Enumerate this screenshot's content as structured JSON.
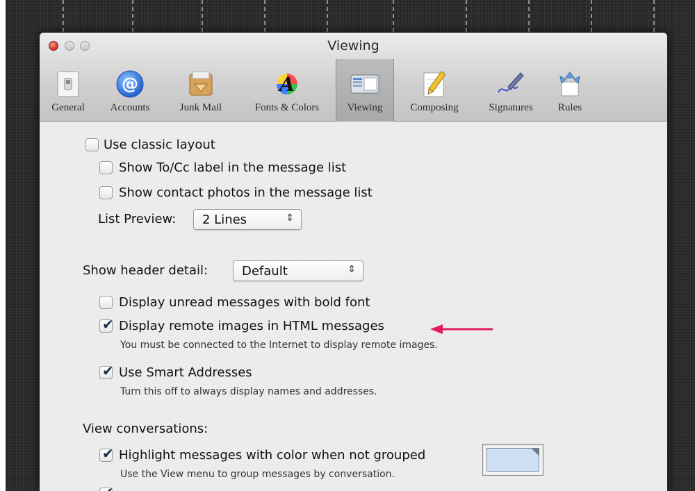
{
  "window": {
    "title": "Viewing"
  },
  "toolbar": {
    "items": [
      {
        "label": "General"
      },
      {
        "label": "Accounts"
      },
      {
        "label": "Junk Mail"
      },
      {
        "label": "Fonts & Colors"
      },
      {
        "label": "Viewing"
      },
      {
        "label": "Composing"
      },
      {
        "label": "Signatures"
      },
      {
        "label": "Rules"
      }
    ]
  },
  "settings": {
    "classic_layout": {
      "label": "Use classic layout",
      "checked": false
    },
    "show_tocc": {
      "label": "Show To/Cc label in the message list",
      "checked": false
    },
    "show_photos": {
      "label": "Show contact photos in the message list",
      "checked": false
    },
    "list_preview": {
      "label": "List Preview:",
      "value": "2 Lines"
    },
    "header_detail": {
      "label": "Show header detail:",
      "value": "Default"
    },
    "bold_unread": {
      "label": "Display unread messages with bold font",
      "checked": false
    },
    "remote_images": {
      "label": "Display remote images in HTML messages",
      "hint": "You must be connected to the Internet to display remote images.",
      "checked": true
    },
    "smart_addresses": {
      "label": "Use Smart Addresses",
      "hint": "Turn this off to always display names and addresses.",
      "checked": true
    },
    "view_conversations": {
      "label": "View conversations:"
    },
    "highlight": {
      "label": "Highlight messages with color when not grouped",
      "hint": "Use the View menu to group messages by conversation.",
      "checked": true
    }
  },
  "colors": {
    "highlight_swatch": "#cfe0f5",
    "annotation_arrow": "#e01e5a"
  }
}
